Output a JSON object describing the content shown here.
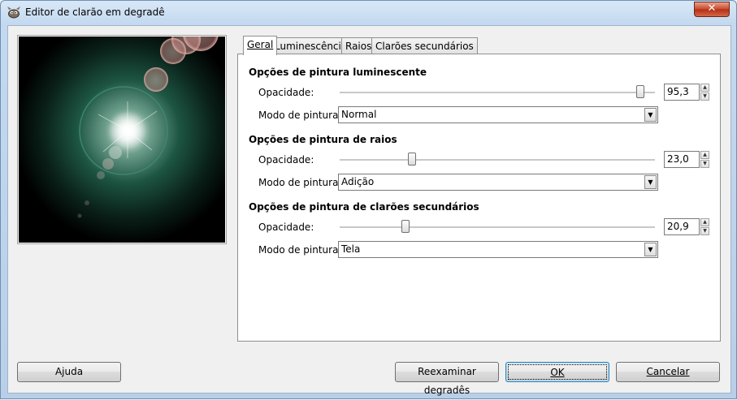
{
  "window": {
    "title": "Editor de clarão em degradê",
    "close_label": "✕"
  },
  "tabs": [
    {
      "label": "Geral",
      "active": true
    },
    {
      "label": "Luminescência",
      "active": false
    },
    {
      "label": "Raios",
      "active": false
    },
    {
      "label": "Clarões secundários",
      "active": false
    }
  ],
  "sections": {
    "glow": {
      "title": "Opções de pintura luminescente",
      "opacity_label": "Opacidade:",
      "opacity_value": "95,3",
      "opacity_fraction": 0.953,
      "mode_label": "Modo de pintura:",
      "mode_value": "Normal"
    },
    "rays": {
      "title": "Opções de pintura de raios",
      "opacity_label": "Opacidade:",
      "opacity_value": "23,0",
      "opacity_fraction": 0.23,
      "mode_label": "Modo de pintura:",
      "mode_value": "Adição"
    },
    "sflares": {
      "title": "Opções de pintura de clarões secundários",
      "opacity_label": "Opacidade:",
      "opacity_value": "20,9",
      "opacity_fraction": 0.209,
      "mode_label": "Modo de pintura:",
      "mode_value": "Tela"
    }
  },
  "buttons": {
    "help": "Ajuda",
    "rescan": "Reexaminar degradês",
    "ok": "OK",
    "cancel": "Cancelar"
  },
  "colors": {
    "preview_bg": "#000000",
    "glow": "#1b5a47",
    "flare_pink": "#e8b4b0"
  }
}
